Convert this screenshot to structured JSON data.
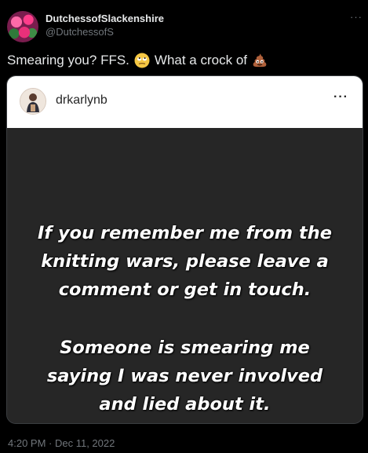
{
  "author": {
    "display_name": "DutchessofSlackenshire",
    "handle": "@DutchessofS",
    "avatar_icon": "roses-avatar"
  },
  "more_icon": "more-horizontal-icon",
  "tweet": {
    "text_part1": "Smearing you?  FFS.",
    "emoji1": "rolling-eyes-emoji",
    "text_part2": "What a crock of",
    "emoji2": "pile-of-poo-emoji"
  },
  "embed": {
    "username": "drkarlynb",
    "more_label": "···",
    "story_paragraph1": [
      "If you remember me from the",
      "knitting wars, please leave a",
      "comment or get in touch."
    ],
    "story_paragraph2": [
      "Someone is smearing me",
      "saying I was never involved",
      "and lied about it."
    ]
  },
  "timestamp": "4:20 PM · Dec 11, 2022",
  "colors": {
    "background": "#000000",
    "text": "#e7e9ea",
    "muted": "#71767b",
    "card_header": "#ffffff",
    "story_background": "#262626"
  }
}
